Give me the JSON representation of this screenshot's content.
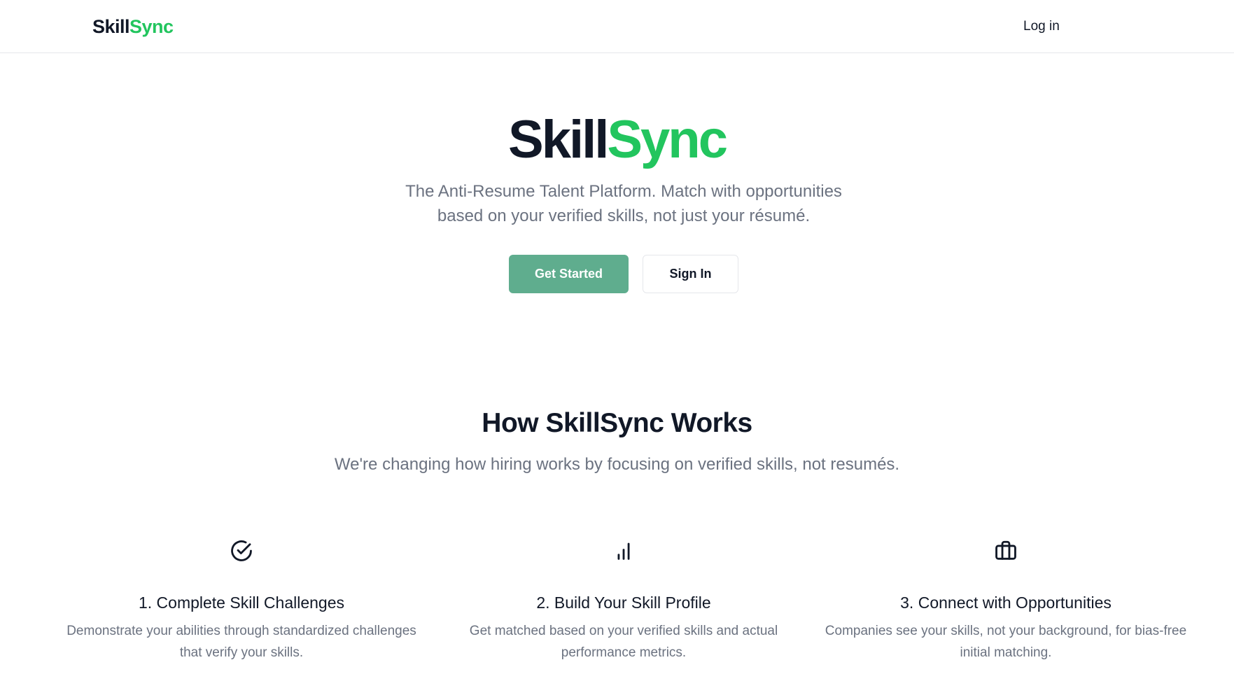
{
  "header": {
    "brand_part1": "Skill",
    "brand_part2": "Sync",
    "login_label": "Log in"
  },
  "hero": {
    "logo_part1": "Skill",
    "logo_part2": "Sync",
    "subtitle": "The Anti-Resume Talent Platform. Match with opportunities based on your verified skills, not just your résumé.",
    "primary_button": "Get Started",
    "secondary_button": "Sign In"
  },
  "how_it_works": {
    "title": "How SkillSync Works",
    "subtitle": "We're changing how hiring works by focusing on verified skills, not resumés.",
    "features": [
      {
        "icon": "check-circle-icon",
        "title": "1. Complete Skill Challenges",
        "description": "Demonstrate your abilities through standardized challenges that verify your skills."
      },
      {
        "icon": "bar-chart-icon",
        "title": "2. Build Your Skill Profile",
        "description": "Get matched based on your verified skills and actual performance metrics."
      },
      {
        "icon": "briefcase-icon",
        "title": "3. Connect with Opportunities",
        "description": "Companies see your skills, not your background, for bias-free initial matching."
      }
    ]
  },
  "colors": {
    "brand_green": "#22c55e",
    "primary_button": "#5fad8e",
    "text_dark": "#111827",
    "text_muted": "#6b7280"
  }
}
